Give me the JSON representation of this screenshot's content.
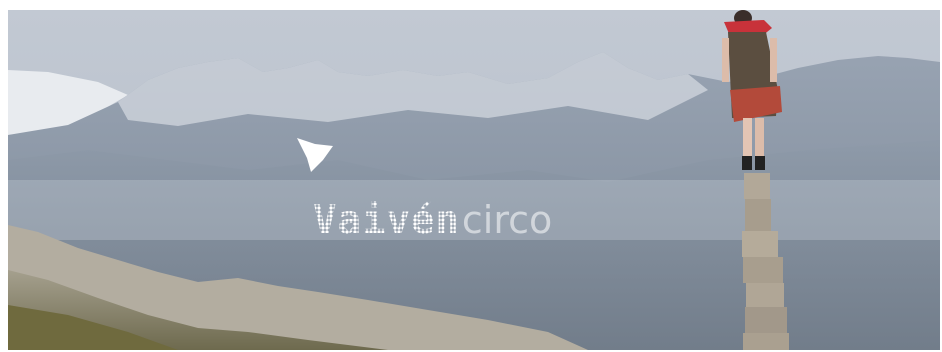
{
  "hero": {
    "logo": {
      "word_primary": "Vaivén",
      "word_secondary": "circo"
    },
    "icons": {
      "logo_mark": "bird-icon"
    },
    "colors": {
      "sky": "#c9cfd8",
      "mountains": "#8a97a8",
      "snow": "#e6e9ee",
      "foreground_slope": "#7d7a5a",
      "pillar": "#a89e90",
      "logo": "#ffffff"
    }
  }
}
